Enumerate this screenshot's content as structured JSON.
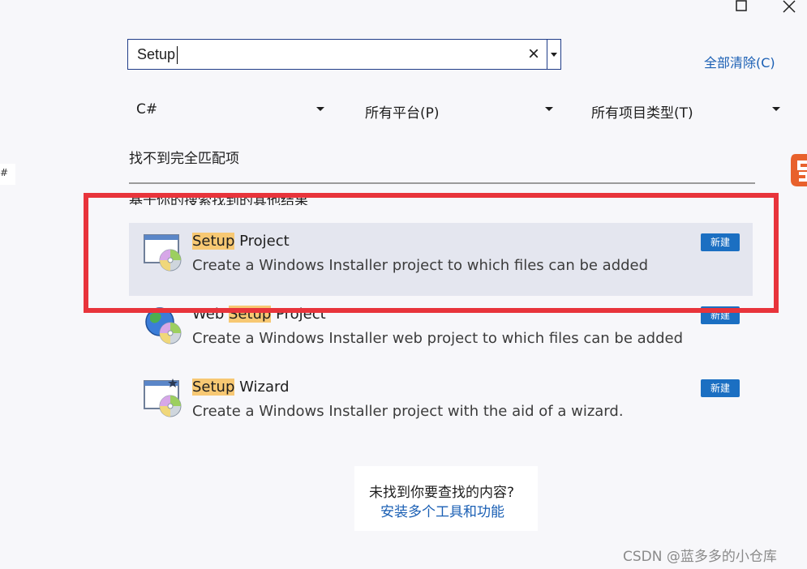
{
  "window": {
    "maximize_icon": "maximize-icon",
    "close_icon": "close-icon"
  },
  "search": {
    "value": "Setup",
    "clear_glyph": "×",
    "dropdown_icon": "chevron-down-icon"
  },
  "clear_all_label": "全部清除(C)",
  "filters": [
    {
      "label": "C#"
    },
    {
      "label": "所有平台(P)"
    },
    {
      "label": "所有项目类型(T)"
    }
  ],
  "no_exact_match": "找不到完全匹配项",
  "other_results_heading": "基于你的搜索找到的其他结果",
  "results": [
    {
      "title_highlight": "Setup",
      "title_rest": " Project",
      "title_prefix": "",
      "description": "Create a Windows Installer project to which files can be added",
      "badge": "新建",
      "icon": "setup-project-icon"
    },
    {
      "title_prefix": "Web ",
      "title_highlight": "Setup",
      "title_rest": " Project",
      "description": "Create a Windows Installer web project to which files can be added",
      "badge": "新建",
      "icon": "web-setup-project-icon"
    },
    {
      "title_prefix": "",
      "title_highlight": "Setup",
      "title_rest": " Wizard",
      "description": "Create a Windows Installer project with the aid of a wizard.",
      "badge": "新建",
      "icon": "setup-wizard-icon"
    }
  ],
  "not_found": {
    "question": "未找到你要查找的内容?",
    "link": "安装多个工具和功能"
  },
  "side_tab_text": "#",
  "watermark": "CSDN @蓝多多的小仓库",
  "colors": {
    "accent": "#1a5fb4",
    "badge": "#1b6fc2",
    "highlight": "#f7c873",
    "annotation": "#e8343b",
    "selected_row": "#e4e6ef"
  }
}
